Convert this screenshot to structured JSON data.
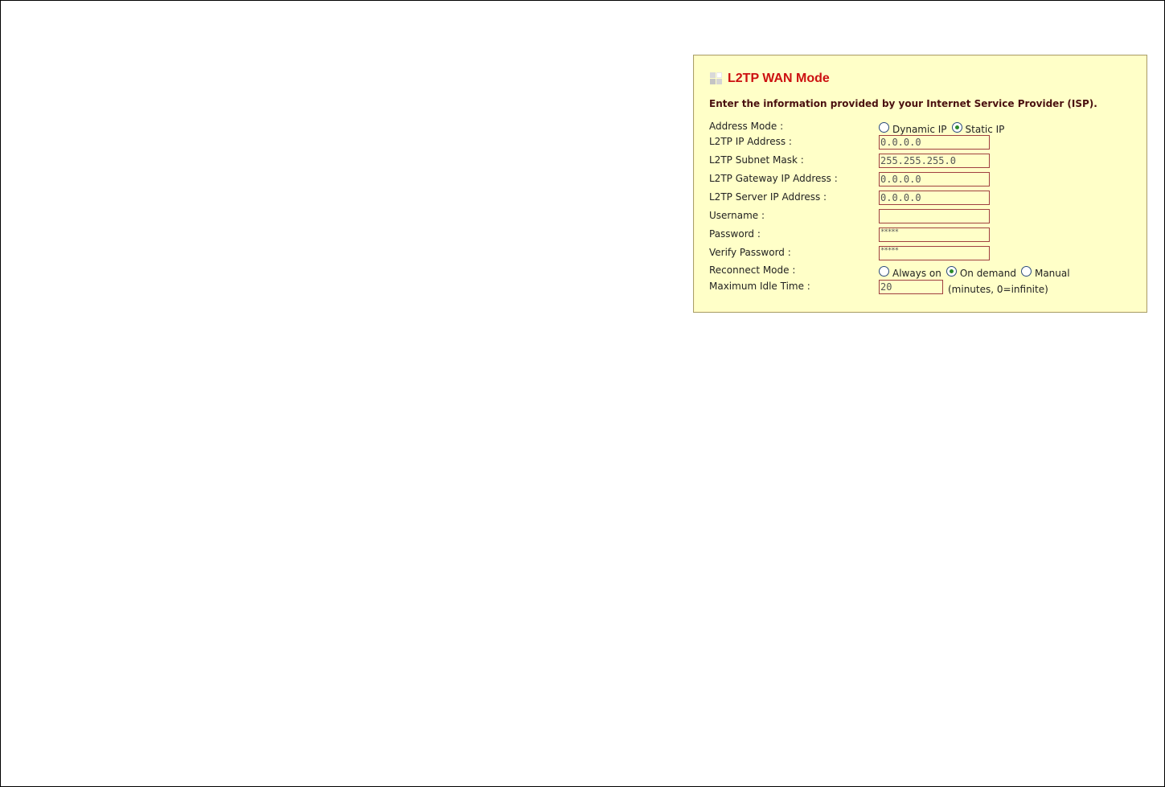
{
  "panel": {
    "title": "L2TP WAN Mode",
    "intro": "Enter the information provided by your Internet Service Provider (ISP)."
  },
  "address_mode": {
    "label": "Address Mode :",
    "options": [
      "Dynamic IP",
      "Static IP"
    ],
    "selected": "Static IP"
  },
  "fields": {
    "ip_address": {
      "label": "L2TP IP Address :",
      "value": "0.0.0.0"
    },
    "subnet_mask": {
      "label": "L2TP Subnet Mask :",
      "value": "255.255.255.0"
    },
    "gateway_ip": {
      "label": "L2TP Gateway IP Address :",
      "value": "0.0.0.0"
    },
    "server_ip": {
      "label": "L2TP Server IP Address :",
      "value": "0.0.0.0"
    },
    "username": {
      "label": "Username :",
      "value": ""
    },
    "password": {
      "label": "Password :",
      "value": "*****"
    },
    "verify_password": {
      "label": "Verify Password :",
      "value": "*****"
    }
  },
  "reconnect_mode": {
    "label": "Reconnect Mode :",
    "options": [
      "Always on",
      "On demand",
      "Manual"
    ],
    "selected": "On demand"
  },
  "idle_time": {
    "label": "Maximum Idle Time :",
    "value": "20",
    "hint": "(minutes, 0=infinite)"
  }
}
